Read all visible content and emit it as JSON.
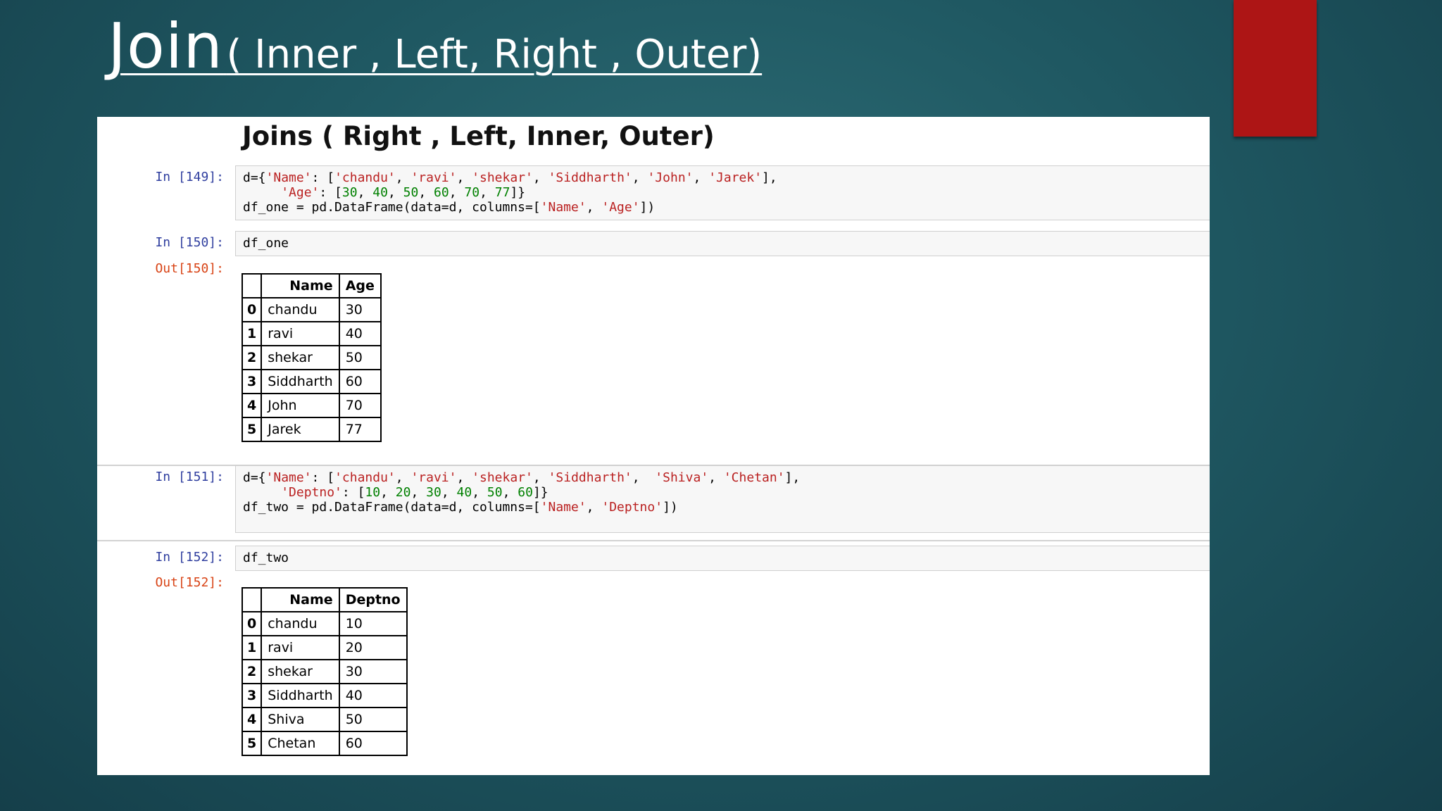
{
  "slide": {
    "title_main": "Join",
    "title_sub": "( Inner , Left, Right , Outer)"
  },
  "notebook": {
    "heading": "Joins ( Right , Left, Inner, Outer)",
    "cells": [
      {
        "prompt": "In [149]:",
        "lines": [
          [
            [
              "t",
              "d={"
            ],
            [
              "s",
              "'Name'"
            ],
            [
              "t",
              ": ["
            ],
            [
              "s",
              "'chandu'"
            ],
            [
              "t",
              ", "
            ],
            [
              "s",
              "'ravi'"
            ],
            [
              "t",
              ", "
            ],
            [
              "s",
              "'shekar'"
            ],
            [
              "t",
              ", "
            ],
            [
              "s",
              "'Siddharth'"
            ],
            [
              "t",
              ", "
            ],
            [
              "s",
              "'John'"
            ],
            [
              "t",
              ", "
            ],
            [
              "s",
              "'Jarek'"
            ],
            [
              "t",
              "],"
            ]
          ],
          [
            [
              "t",
              "     "
            ],
            [
              "s",
              "'Age'"
            ],
            [
              "t",
              ": ["
            ],
            [
              "n",
              "30"
            ],
            [
              "t",
              ", "
            ],
            [
              "n",
              "40"
            ],
            [
              "t",
              ", "
            ],
            [
              "n",
              "50"
            ],
            [
              "t",
              ", "
            ],
            [
              "n",
              "60"
            ],
            [
              "t",
              ", "
            ],
            [
              "n",
              "70"
            ],
            [
              "t",
              ", "
            ],
            [
              "n",
              "77"
            ],
            [
              "t",
              "]}"
            ]
          ],
          [
            [
              "t",
              "df_one = pd.DataFrame(data=d, columns=["
            ],
            [
              "s",
              "'Name'"
            ],
            [
              "t",
              ", "
            ],
            [
              "s",
              "'Age'"
            ],
            [
              "t",
              "])"
            ]
          ]
        ]
      },
      {
        "prompt": "In [150]:",
        "lines": [
          [
            [
              "t",
              "df_one"
            ]
          ]
        ]
      },
      {
        "prompt": "In [151]:",
        "lines": [
          [
            [
              "t",
              "d={"
            ],
            [
              "s",
              "'Name'"
            ],
            [
              "t",
              ": ["
            ],
            [
              "s",
              "'chandu'"
            ],
            [
              "t",
              ", "
            ],
            [
              "s",
              "'ravi'"
            ],
            [
              "t",
              ", "
            ],
            [
              "s",
              "'shekar'"
            ],
            [
              "t",
              ", "
            ],
            [
              "s",
              "'Siddharth'"
            ],
            [
              "t",
              ",  "
            ],
            [
              "s",
              "'Shiva'"
            ],
            [
              "t",
              ", "
            ],
            [
              "s",
              "'Chetan'"
            ],
            [
              "t",
              "],"
            ]
          ],
          [
            [
              "t",
              "     "
            ],
            [
              "s",
              "'Deptno'"
            ],
            [
              "t",
              ": ["
            ],
            [
              "n",
              "10"
            ],
            [
              "t",
              ", "
            ],
            [
              "n",
              "20"
            ],
            [
              "t",
              ", "
            ],
            [
              "n",
              "30"
            ],
            [
              "t",
              ", "
            ],
            [
              "n",
              "40"
            ],
            [
              "t",
              ", "
            ],
            [
              "n",
              "50"
            ],
            [
              "t",
              ", "
            ],
            [
              "n",
              "60"
            ],
            [
              "t",
              "]}"
            ]
          ],
          [
            [
              "t",
              "df_two = pd.DataFrame(data=d, columns=["
            ],
            [
              "s",
              "'Name'"
            ],
            [
              "t",
              ", "
            ],
            [
              "s",
              "'Deptno'"
            ],
            [
              "t",
              "])"
            ]
          ]
        ]
      },
      {
        "prompt": "In [152]:",
        "lines": [
          [
            [
              "t",
              "df_two"
            ]
          ]
        ]
      }
    ],
    "outputs": [
      {
        "prompt": "Out[150]:",
        "columns": [
          "",
          "Name",
          "Age"
        ],
        "rows": [
          [
            "0",
            "chandu",
            "30"
          ],
          [
            "1",
            "ravi",
            "40"
          ],
          [
            "2",
            "shekar",
            "50"
          ],
          [
            "3",
            "Siddharth",
            "60"
          ],
          [
            "4",
            "John",
            "70"
          ],
          [
            "5",
            "Jarek",
            "77"
          ]
        ]
      },
      {
        "prompt": "Out[152]:",
        "columns": [
          "",
          "Name",
          "Deptno"
        ],
        "rows": [
          [
            "0",
            "chandu",
            "10"
          ],
          [
            "1",
            "ravi",
            "20"
          ],
          [
            "2",
            "shekar",
            "30"
          ],
          [
            "3",
            "Siddharth",
            "40"
          ],
          [
            "4",
            "Shiva",
            "50"
          ],
          [
            "5",
            "Chetan",
            "60"
          ]
        ]
      }
    ]
  },
  "colors": {
    "background": "#1f5862",
    "accent_tab": "#ad1515",
    "in_prompt": "#303f9f",
    "out_prompt": "#d84315",
    "string": "#ba2121",
    "number": "#008000"
  }
}
